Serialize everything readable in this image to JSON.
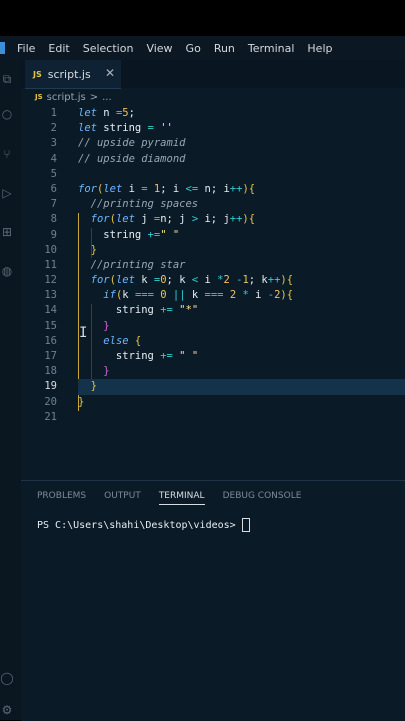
{
  "menu": [
    "File",
    "Edit",
    "Selection",
    "View",
    "Go",
    "Run",
    "Terminal",
    "Help"
  ],
  "tab": {
    "icon": "JS",
    "name": "script.js",
    "close": "✕"
  },
  "breadcrumb": {
    "icon": "JS",
    "file": "script.js",
    "sep": ">",
    "more": "..."
  },
  "line_numbers": [
    "1",
    "2",
    "3",
    "4",
    "5",
    "6",
    "7",
    "8",
    "9",
    "10",
    "11",
    "12",
    "13",
    "14",
    "15",
    "16",
    "17",
    "18",
    "19",
    "20",
    "21"
  ],
  "code": [
    "let n =5;",
    "let string = ''",
    "// upside pyramid",
    "// upside diamond",
    "",
    "for(let i = 1; i <= n; i++){",
    "  //printing spaces",
    "  for(let j =n; j > i; j++){",
    "    string +=\" \"",
    "  }",
    "  //printing star",
    "  for(let k =0; k < i *2 -1; k++){",
    "    if(k === 0 || k === 2 * i -2){",
    "      string += \"*\"",
    "    }",
    "    else {",
    "      string += \" \"",
    "    }",
    "  }",
    "}",
    ""
  ],
  "panel_tabs": [
    "PROBLEMS",
    "OUTPUT",
    "TERMINAL",
    "DEBUG CONSOLE"
  ],
  "active_panel_tab": "TERMINAL",
  "terminal_prompt": "PS C:\\Users\\shahi\\Desktop\\videos> "
}
